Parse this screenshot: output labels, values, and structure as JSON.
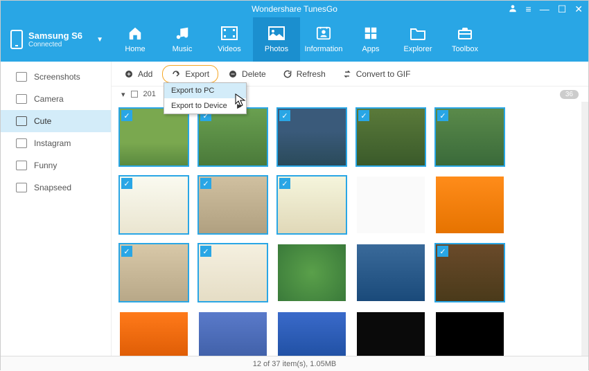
{
  "app_title": "Wondershare TunesGo",
  "device": {
    "name": "Samsung S6",
    "status": "Connected"
  },
  "nav": [
    {
      "label": "Home"
    },
    {
      "label": "Music"
    },
    {
      "label": "Videos"
    },
    {
      "label": "Photos"
    },
    {
      "label": "Information"
    },
    {
      "label": "Apps"
    },
    {
      "label": "Explorer"
    },
    {
      "label": "Toolbox"
    }
  ],
  "nav_active": 3,
  "sidebar": [
    {
      "label": "Screenshots"
    },
    {
      "label": "Camera"
    },
    {
      "label": "Cute"
    },
    {
      "label": "Instagram"
    },
    {
      "label": "Funny"
    },
    {
      "label": "Snapseed"
    }
  ],
  "sidebar_active": 2,
  "toolbar": {
    "add": "Add",
    "export": "Export",
    "delete": "Delete",
    "refresh": "Refresh",
    "convert": "Convert to GIF"
  },
  "export_menu": [
    {
      "label": "Export to PC"
    },
    {
      "label": "Export to Device"
    }
  ],
  "group": {
    "year": "201",
    "count": "36"
  },
  "thumbs": [
    {
      "sel": true
    },
    {
      "sel": true
    },
    {
      "sel": true
    },
    {
      "sel": true
    },
    {
      "sel": true
    },
    {
      "sel": true
    },
    {
      "sel": true
    },
    {
      "sel": true
    },
    {
      "sel": false
    },
    {
      "sel": false
    },
    {
      "sel": true
    },
    {
      "sel": true
    },
    {
      "sel": false
    },
    {
      "sel": false
    },
    {
      "sel": true
    },
    {
      "sel": false
    },
    {
      "sel": false
    },
    {
      "sel": false
    },
    {
      "sel": false
    },
    {
      "sel": false
    }
  ],
  "status": "12 of 37 item(s), 1.05MB"
}
